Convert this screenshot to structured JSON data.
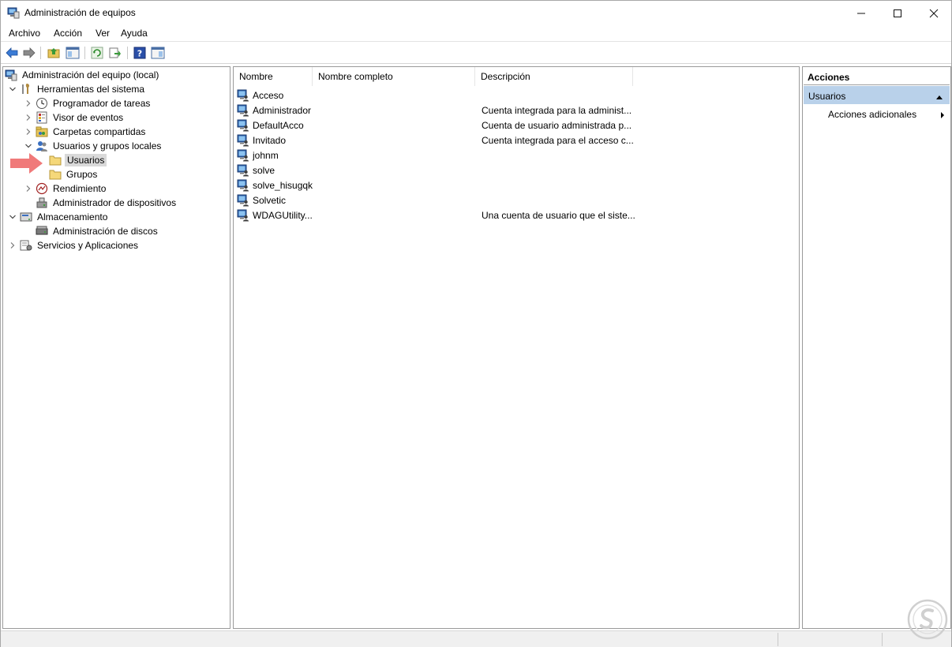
{
  "window": {
    "title": "Administración de equipos"
  },
  "menu": [
    "Archivo",
    "Acción",
    "Ver",
    "Ayuda"
  ],
  "tree": {
    "root": "Administración del equipo (local)",
    "herramientas": "Herramientas del sistema",
    "programador": "Programador de tareas",
    "visor": "Visor de eventos",
    "carpetas": "Carpetas compartidas",
    "usuarios_grupos": "Usuarios y grupos locales",
    "usuarios": "Usuarios",
    "grupos": "Grupos",
    "rendimiento": "Rendimiento",
    "admin_dispositivos": "Administrador de dispositivos",
    "almacenamiento": "Almacenamiento",
    "admin_discos": "Administración de discos",
    "servicios": "Servicios y Aplicaciones"
  },
  "columns": [
    "Nombre",
    "Nombre completo",
    "Descripción"
  ],
  "users": [
    {
      "name": "Acceso",
      "fullname": "",
      "description": ""
    },
    {
      "name": "Administrador",
      "fullname": "",
      "description": "Cuenta integrada para la administ..."
    },
    {
      "name": "DefaultAcco",
      "fullname": "",
      "description": "Cuenta de usuario administrada p..."
    },
    {
      "name": "Invitado",
      "fullname": "",
      "description": "Cuenta integrada para el acceso c..."
    },
    {
      "name": "johnm",
      "fullname": "",
      "description": ""
    },
    {
      "name": "solve",
      "fullname": "",
      "description": ""
    },
    {
      "name": "solve_hisugqk",
      "fullname": "",
      "description": ""
    },
    {
      "name": "Solvetic",
      "fullname": "",
      "description": ""
    },
    {
      "name": "WDAGUtility...",
      "fullname": "",
      "description": "Una cuenta de usuario que el siste..."
    }
  ],
  "actions": {
    "header": "Acciones",
    "section": "Usuarios",
    "item": "Acciones adicionales"
  },
  "colors": {
    "selection": "#d9d9d9",
    "actions_section": "#b9d1ea",
    "annotation_arrow": "#f07a7a"
  }
}
